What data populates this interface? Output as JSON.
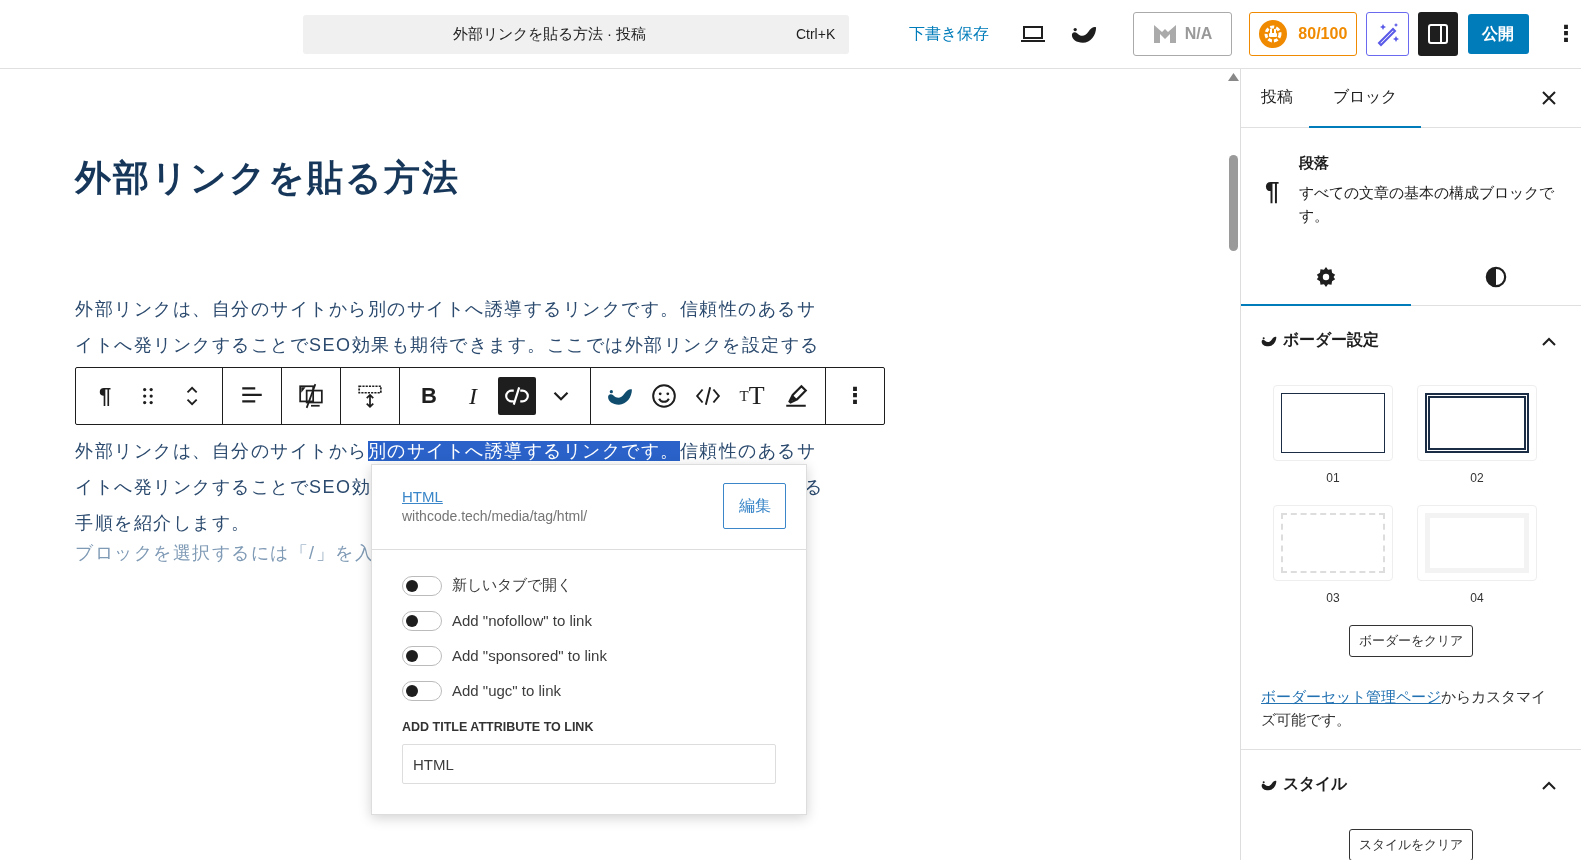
{
  "topbar": {
    "command_bar": {
      "title": "外部リンクを貼る方法 · 投稿",
      "shortcut": "Ctrl+K"
    },
    "save_draft": "下書き保存",
    "seo_badge": "N/A",
    "score": "80/100",
    "sidebar_toggle": {
      "pressed": true
    },
    "publish": "公開",
    "more": "⋮"
  },
  "editor": {
    "title": "外部リンクを貼る方法",
    "paragraph_1": [
      "外部リンクは、自分のサイトから別のサイトへ誘導するリンクです。信頼性のあるサ",
      "イトへ発リンクすることでSEO効果も期待できます。ここでは外部リンクを設定する"
    ],
    "paragraph_2": [
      {
        "segments": [
          {
            "text": "外部リンクは、自分のサイトから",
            "selected": false
          },
          {
            "text": "別のサイトへ誘導するリンクです。",
            "selected": true
          },
          {
            "text": "信頼性のあるサ",
            "selected": false
          }
        ]
      },
      {
        "segments": [
          {
            "text": "イトへ発リンクすることでSEO効",
            "selected": false
          }
        ],
        "trailing": "る"
      },
      {
        "segments": [
          {
            "text": "手順を紹介します。",
            "selected": false
          }
        ]
      }
    ],
    "placeholder": "ブロックを選択するには「/」を入"
  },
  "block_toolbar": {
    "groups": [
      {
        "items": [
          {
            "kind": "paragraph",
            "glyph": "¶",
            "active": false
          },
          {
            "kind": "drag",
            "active": false
          },
          {
            "kind": "move",
            "active": false
          }
        ]
      },
      {
        "items": [
          {
            "kind": "align",
            "active": false
          }
        ]
      },
      {
        "items": [
          {
            "kind": "device",
            "active": false
          }
        ]
      },
      {
        "items": [
          {
            "kind": "spacing",
            "active": false
          }
        ]
      },
      {
        "items": [
          {
            "kind": "bold",
            "glyph": "B",
            "active": false
          },
          {
            "kind": "italic",
            "glyph": "I",
            "active": false
          },
          {
            "kind": "unlink",
            "active": true
          },
          {
            "kind": "chevron",
            "active": false
          }
        ]
      },
      {
        "items": [
          {
            "kind": "swell",
            "active": false
          },
          {
            "kind": "emoji",
            "active": false
          },
          {
            "kind": "code",
            "active": false
          },
          {
            "kind": "text-size",
            "glyphs": [
              "T",
              "T"
            ],
            "active": false
          },
          {
            "kind": "highlight",
            "active": false
          }
        ]
      },
      {
        "items": [
          {
            "kind": "options",
            "glyph": "⋮",
            "active": false
          }
        ]
      }
    ]
  },
  "link_popover": {
    "link_title": "HTML",
    "url": "withcode.tech/media/tag/html/",
    "edit_button": "編集",
    "toggles": [
      {
        "label": "新しいタブで開く",
        "on": false
      },
      {
        "label": "Add \"nofollow\" to link",
        "on": false
      },
      {
        "label": "Add \"sponsored\" to link",
        "on": false
      },
      {
        "label": "Add \"ugc\" to link",
        "on": false
      }
    ],
    "title_field": {
      "label": "ADD TITLE ATTRIBUTE TO LINK",
      "value": "HTML"
    }
  },
  "sidebar": {
    "tabs": [
      {
        "label": "投稿",
        "selected": false
      },
      {
        "label": "ブロック",
        "selected": true
      }
    ],
    "block": {
      "icon": "¶",
      "name": "段落",
      "description": "すべての文章の基本の構成ブロックです。"
    },
    "inspector_tabs": [
      {
        "kind": "settings",
        "selected": true
      },
      {
        "kind": "styles",
        "selected": false
      }
    ],
    "border_panel": {
      "title": "ボーダー設定",
      "expanded": true,
      "presets": [
        {
          "label": "01",
          "kind": "solid"
        },
        {
          "label": "02",
          "kind": "double"
        },
        {
          "label": "03",
          "kind": "dashed"
        },
        {
          "label": "04",
          "kind": "thick-light"
        }
      ],
      "clear_button": "ボーダーをクリア",
      "note_link": "ボーダーセット管理ページ",
      "note_text": "からカスタマイズ可能です。"
    },
    "style_panel": {
      "title": "スタイル",
      "expanded": true,
      "clear_button": "スタイルをクリア"
    }
  }
}
